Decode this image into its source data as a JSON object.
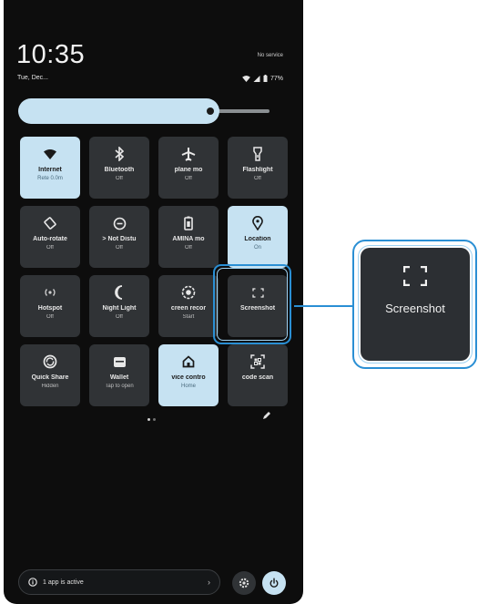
{
  "status_bar": {
    "time": "10:35",
    "date": "Tue, Dec...",
    "carrier": "No service",
    "battery": "77%"
  },
  "brightness": {
    "level": 0.78
  },
  "tiles": [
    {
      "label": "Internet",
      "sub": "Rete 0.0m",
      "on": true,
      "icon": "wifi-icon"
    },
    {
      "label": "Bluetooth",
      "sub": "Off",
      "on": false,
      "icon": "bluetooth-icon"
    },
    {
      "label": "plane mo",
      "sub": "Off",
      "on": false,
      "icon": "airplane-icon"
    },
    {
      "label": "Flashlight",
      "sub": "Off",
      "on": false,
      "icon": "flashlight-icon"
    },
    {
      "label": "Auto-rotate",
      "sub": "Off",
      "on": false,
      "icon": "rotate-icon"
    },
    {
      "label": "> Not Distu",
      "sub": "Off",
      "on": false,
      "icon": "do-not-disturb-icon"
    },
    {
      "label": "AMINA mo",
      "sub": "Off",
      "on": false,
      "icon": "battery-saver-icon"
    },
    {
      "label": "Location",
      "sub": "On",
      "on": true,
      "icon": "location-icon"
    },
    {
      "label": "Hotspot",
      "sub": "Off",
      "on": false,
      "icon": "hotspot-icon"
    },
    {
      "label": "Night Light",
      "sub": "Off",
      "on": false,
      "icon": "moon-icon"
    },
    {
      "label": "creen recor",
      "sub": "Start",
      "on": false,
      "icon": "screen-record-icon"
    },
    {
      "label": "Screenshot",
      "sub": "",
      "on": false,
      "icon": "screenshot-icon"
    },
    {
      "label": "Quick Share",
      "sub": "Hidden",
      "on": false,
      "icon": "quick-share-icon"
    },
    {
      "label": "Wallet",
      "sub": "Tap to open",
      "on": false,
      "icon": "wallet-icon"
    },
    {
      "label": "vice contro",
      "sub": "Home",
      "on": true,
      "icon": "home-icon"
    },
    {
      "label": "code scan",
      "sub": "",
      "on": false,
      "icon": "qr-scan-icon"
    }
  ],
  "zoom_callout": {
    "label": "Screenshot",
    "icon": "screenshot-icon"
  },
  "footer": {
    "active_apps": "1 app is active"
  },
  "colors": {
    "tile_on": "#c6e2f2",
    "tile_off": "#303336",
    "highlight": "#2a8fd4",
    "background": "#0d0d0d"
  }
}
